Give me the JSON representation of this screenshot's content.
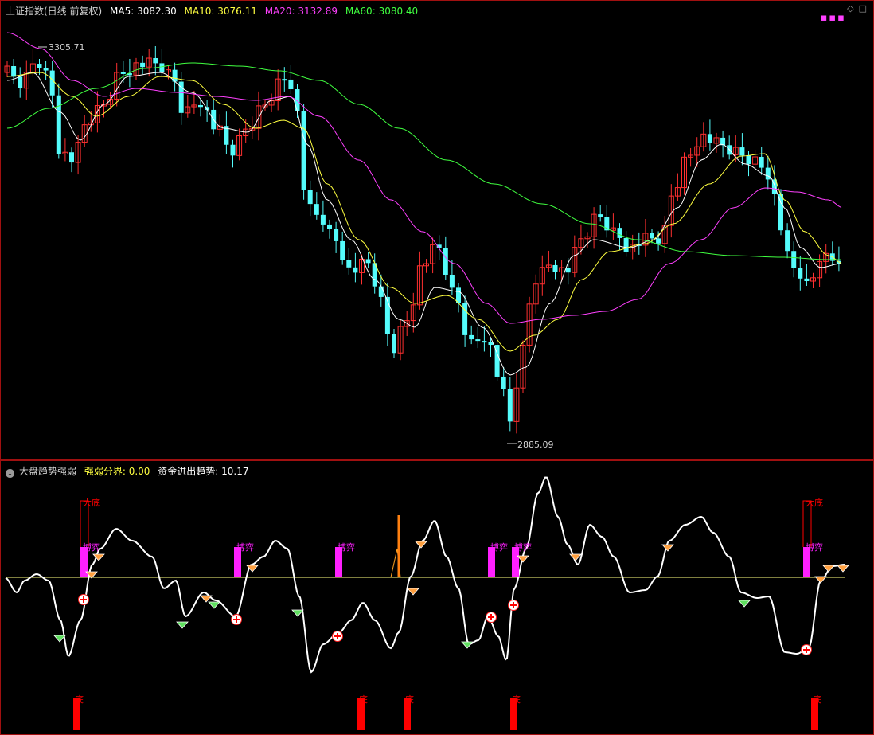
{
  "main_chart": {
    "title": "上证指数(日线 前复权)",
    "ma": [
      {
        "label": "MA5:",
        "value": "3082.30",
        "color": "#ffffff"
      },
      {
        "label": "MA10:",
        "value": "3076.11",
        "color": "#ffff40"
      },
      {
        "label": "MA20:",
        "value": "3132.89",
        "color": "#ff40ff"
      },
      {
        "label": "MA60:",
        "value": "3080.40",
        "color": "#40ff40"
      }
    ],
    "high_label": "3305.71",
    "low_label": "2885.09",
    "colors": {
      "up": "#ff3030",
      "down": "#54fcfc"
    }
  },
  "indicator": {
    "title": "大盘趋势强弱",
    "params": [
      {
        "label": "强弱分界:",
        "value": "0.00",
        "color": "#ffff40"
      },
      {
        "label": "资金进出趋势:",
        "value": "10.17",
        "color": "#ffffff"
      }
    ],
    "labels": {
      "big_bottom": "大底",
      "game": "博弈",
      "bottom": "底"
    },
    "colors": {
      "bar": "#ff20ff",
      "bottom": "#ff0000",
      "line": "#ffffff"
    }
  },
  "icons": {
    "collapse": "chevron-circle-icon",
    "diamond": "diamond-icon",
    "maximize": "maximize-icon"
  }
}
